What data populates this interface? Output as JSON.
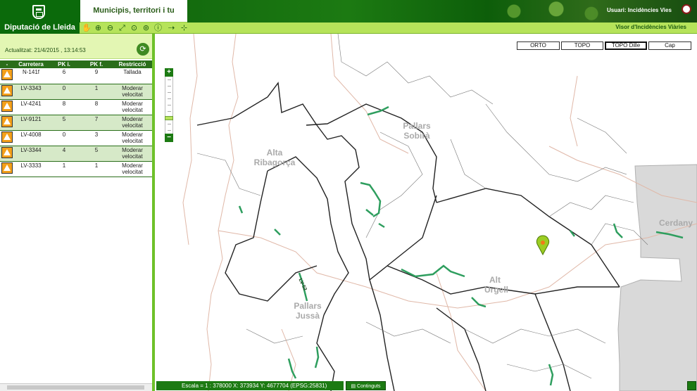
{
  "header": {
    "brand": "Diputació de Lleida",
    "tagline": "Municipis, territori i tu",
    "user_label": "Usuari: Incidències Vies",
    "visor_title": "Visor d'Incidències Viàries"
  },
  "toolbar": {
    "tools": [
      "pan-icon",
      "zoom-in-icon",
      "zoom-out-icon",
      "full-extent-icon",
      "zoom-previous-icon",
      "zoom-next-icon",
      "info-icon",
      "measure-icon",
      "crosshair-icon"
    ]
  },
  "panel": {
    "updated": "Actualitzat: 21/4/2015 , 13:14:53",
    "columns": [
      "-",
      "Carretera",
      "PK i.",
      "PK f.",
      "Restricció"
    ],
    "rows": [
      {
        "road": "N-141f",
        "pki": "6",
        "pkf": "9",
        "restriction": "Tallada"
      },
      {
        "road": "LV-3343",
        "pki": "0",
        "pkf": "1",
        "restriction": "Moderar velocitat"
      },
      {
        "road": "LV-4241",
        "pki": "8",
        "pkf": "8",
        "restriction": "Moderar velocitat"
      },
      {
        "road": "LV-9121",
        "pki": "5",
        "pkf": "7",
        "restriction": "Moderar velocitat"
      },
      {
        "road": "LV-4008",
        "pki": "0",
        "pkf": "3",
        "restriction": "Moderar velocitat"
      },
      {
        "road": "LV-3344",
        "pki": "4",
        "pkf": "5",
        "restriction": "Moderar velocitat"
      },
      {
        "road": "LV-3333",
        "pki": "1",
        "pkf": "1",
        "restriction": "Moderar velocitat"
      }
    ]
  },
  "map": {
    "layers": [
      "ORTO",
      "TOPO",
      "TOPO Dille",
      "Cap"
    ],
    "active_layer": "TOPO Dille",
    "labels": [
      "Pallars Sobirà",
      "Alta Ribagorça",
      "Alt Urgell",
      "Pallars Jussà",
      "Cerdany"
    ],
    "road_label": "LV-52",
    "scale": "Escala = 1 : 378000",
    "coords": "X: 373934 Y: 4677704 (EPSG:25831)",
    "contents_label": "Continguts"
  },
  "colors": {
    "brand_green": "#1c7a12",
    "toolbar_green": "#b6e35a",
    "incident_road": "#2e9e5e",
    "border_line": "#222222",
    "road_line": "#e0b8a8"
  }
}
